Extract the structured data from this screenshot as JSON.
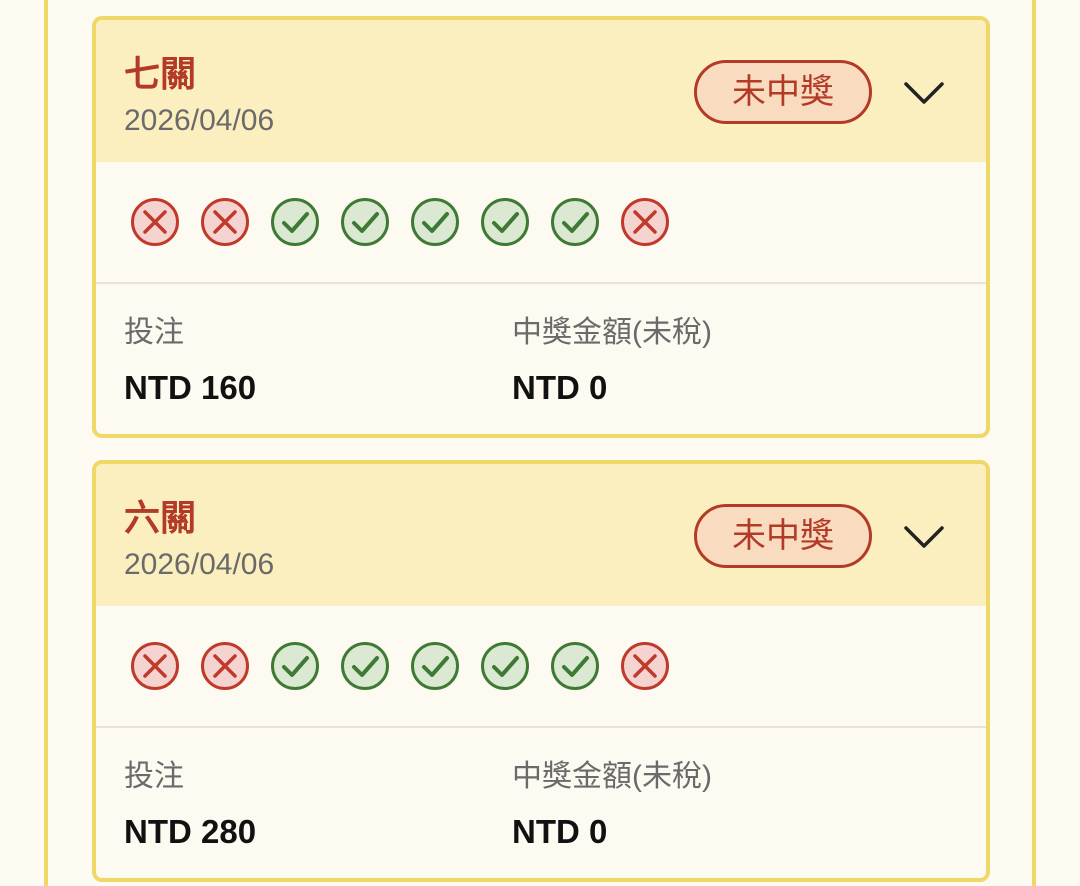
{
  "cards": [
    {
      "title": "七關",
      "date": "2026/04/06",
      "status": "未中獎",
      "results": [
        "miss",
        "miss",
        "hit",
        "hit",
        "hit",
        "hit",
        "hit",
        "miss"
      ],
      "bet_label": "投注",
      "bet_value": "NTD 160",
      "prize_label": "中獎金額(未稅)",
      "prize_value": "NTD 0"
    },
    {
      "title": "六關",
      "date": "2026/04/06",
      "status": "未中獎",
      "results": [
        "miss",
        "miss",
        "hit",
        "hit",
        "hit",
        "hit",
        "hit",
        "miss"
      ],
      "bet_label": "投注",
      "bet_value": "NTD 280",
      "prize_label": "中獎金額(未稅)",
      "prize_value": "NTD 0"
    }
  ],
  "colors": {
    "miss": "#c0392b",
    "miss_fill": "#f5d3d0",
    "hit": "#3f7a35",
    "hit_fill": "#dbe8d2",
    "accent": "#b23a27",
    "border": "#f0d868"
  },
  "icons": {
    "miss": "x-circle-icon",
    "hit": "check-circle-icon",
    "expand": "chevron-down-icon"
  }
}
